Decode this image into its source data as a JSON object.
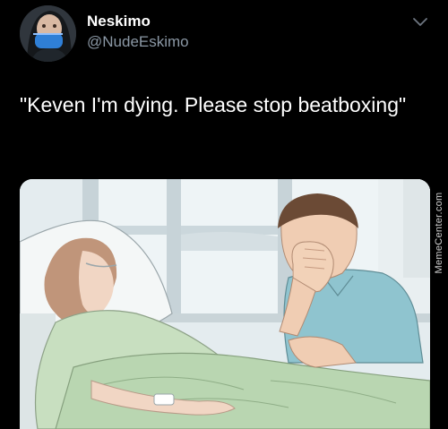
{
  "author": {
    "display_name": "Neskimo",
    "handle": "@NudeEskimo",
    "avatar_icon": "profile-photo-with-blue-mask"
  },
  "tweet": {
    "text": "\"Keven I'm dying. Please stop beatboxing\"",
    "menu_icon": "chevron-down-icon"
  },
  "media": {
    "watermark": "MemeCenter.com"
  },
  "colors": {
    "background": "#000000",
    "text_primary": "#ffffff",
    "text_secondary": "#8b98a5"
  }
}
